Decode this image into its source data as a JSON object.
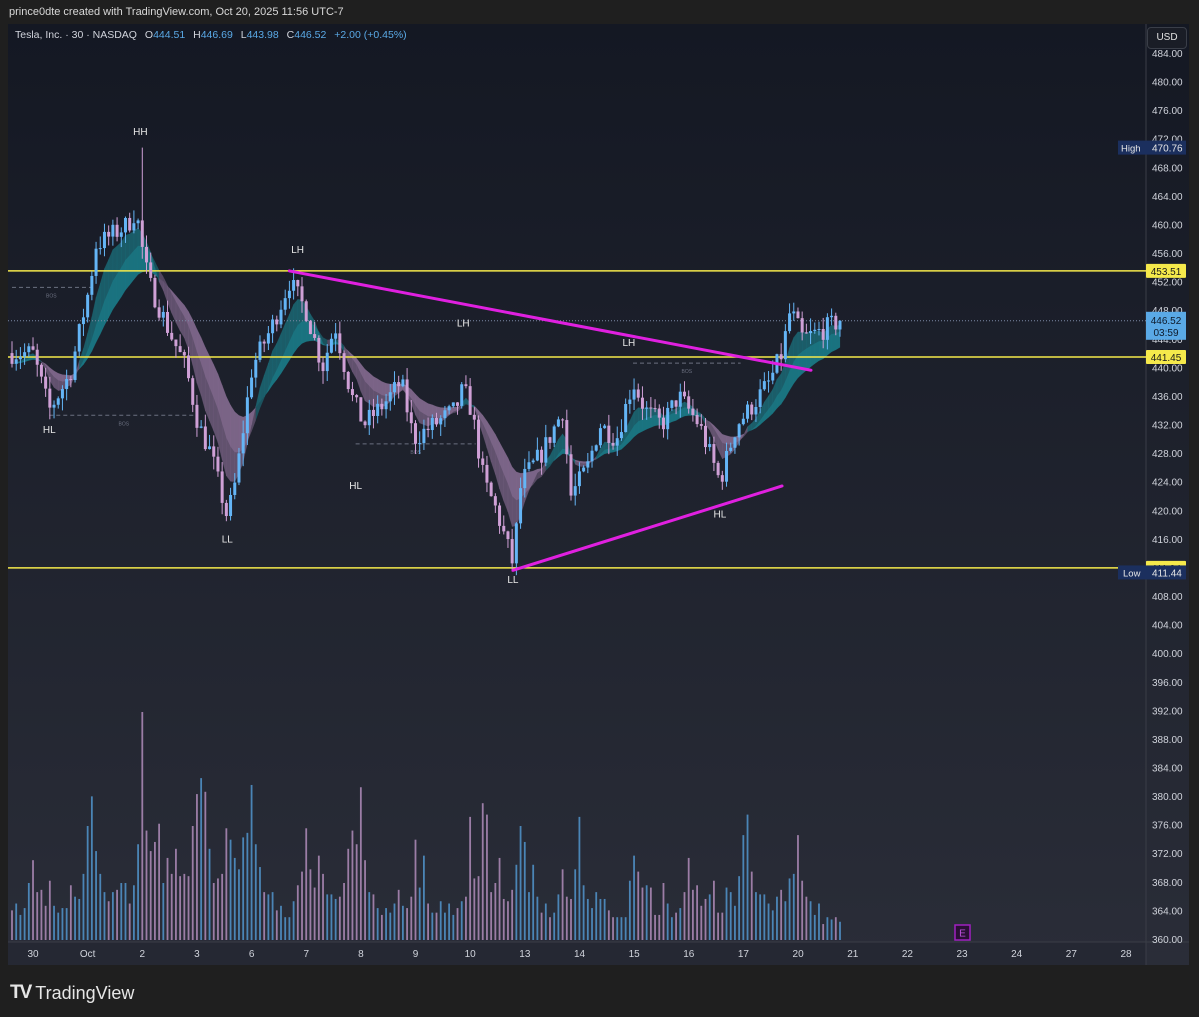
{
  "credit": "prince0dte created with TradingView.com, Oct 20, 2025 11:56 UTC-7",
  "legend": {
    "symbol": "Tesla, Inc. · 30 · NASDAQ",
    "o_label": "O",
    "o": "444.51",
    "h_label": "H",
    "h": "446.69",
    "l_label": "L",
    "l": "443.98",
    "c_label": "C",
    "c": "446.52",
    "change": "+2.00 (+0.45%)"
  },
  "currency_button": "USD",
  "branding": {
    "mark": "TV",
    "name": "TradingView"
  },
  "colors": {
    "up": "#64b5f6",
    "down": "#cfa0d6",
    "ribbon_up": "#1b8f9c",
    "ribbon_down": "#9a7aa5",
    "level": "#f5e94b",
    "trendline": "#e020e0",
    "vol_up": "#4f8fc4",
    "vol_down": "#a886b2"
  },
  "chart_data": {
    "type": "candlestick",
    "title": "Tesla, Inc. · 30 · NASDAQ",
    "interval": "30",
    "ylim": [
      360,
      484
    ],
    "y_ticks": [
      "484.00",
      "480.00",
      "476.00",
      "472.00",
      "468.00",
      "464.00",
      "460.00",
      "456.00",
      "452.00",
      "448.00",
      "444.00",
      "440.00",
      "436.00",
      "432.00",
      "428.00",
      "424.00",
      "420.00",
      "416.00",
      "412.00",
      "408.00",
      "404.00",
      "400.00",
      "396.00",
      "392.00",
      "388.00",
      "384.00",
      "380.00",
      "376.00",
      "372.00",
      "368.00",
      "364.00",
      "360.00"
    ],
    "x_ticks": [
      "30",
      "Oct",
      "2",
      "3",
      "6",
      "7",
      "8",
      "9",
      "10",
      "13",
      "14",
      "15",
      "16",
      "17",
      "20",
      "21",
      "22",
      "23",
      "24",
      "27",
      "28"
    ],
    "price_path": [
      [
        0,
        442
      ],
      [
        5,
        442
      ],
      [
        9,
        434
      ],
      [
        14,
        439
      ],
      [
        19,
        452
      ],
      [
        20,
        457
      ],
      [
        28,
        460
      ],
      [
        30,
        462
      ],
      [
        31,
        458
      ],
      [
        33,
        452
      ],
      [
        38,
        445
      ],
      [
        42,
        440
      ],
      [
        45,
        432
      ],
      [
        48,
        428
      ],
      [
        52,
        419
      ],
      [
        54,
        424
      ],
      [
        58,
        440
      ],
      [
        63,
        446
      ],
      [
        67,
        452
      ],
      [
        71,
        448
      ],
      [
        75,
        440
      ],
      [
        78,
        446
      ],
      [
        82,
        436
      ],
      [
        85,
        432
      ],
      [
        90,
        435
      ],
      [
        94,
        438
      ],
      [
        97,
        430
      ],
      [
        102,
        432
      ],
      [
        107,
        434
      ],
      [
        109,
        437
      ],
      [
        111,
        434
      ],
      [
        114,
        424
      ],
      [
        117,
        420
      ],
      [
        121,
        412.5
      ],
      [
        123,
        424
      ],
      [
        128,
        428
      ],
      [
        133,
        434
      ],
      [
        135,
        422
      ],
      [
        139,
        426
      ],
      [
        142,
        432
      ],
      [
        146,
        430
      ],
      [
        150,
        438
      ],
      [
        153,
        434
      ],
      [
        157,
        432
      ],
      [
        161,
        436
      ],
      [
        166,
        432
      ],
      [
        171,
        424
      ],
      [
        175,
        432
      ],
      [
        178,
        434
      ],
      [
        183,
        438
      ],
      [
        186,
        442
      ],
      [
        188,
        448
      ],
      [
        191,
        444
      ],
      [
        195,
        445
      ],
      [
        200,
        446.52
      ]
    ],
    "session_high": {
      "label": "High",
      "value": "470.76",
      "bar": 31
    },
    "session_low": {
      "label": "Low",
      "value": "411.44",
      "bar": 121
    },
    "last_price": {
      "value": "446.52",
      "countdown": "03:59"
    },
    "volume_relative": [
      13,
      16,
      11,
      14,
      25,
      35,
      21,
      22,
      15,
      26,
      15,
      12,
      14,
      14,
      24,
      19,
      18,
      29,
      50,
      63,
      39,
      29,
      21,
      17,
      21,
      22,
      25,
      25,
      16,
      24,
      42,
      100,
      48,
      39,
      43,
      51,
      25,
      36,
      29,
      40,
      28,
      29,
      28,
      50,
      64,
      71,
      65,
      40,
      25,
      27,
      29,
      49,
      44,
      36,
      31,
      45,
      47,
      68,
      42,
      32,
      21,
      20,
      21,
      13,
      15,
      10,
      10,
      17,
      24,
      30,
      49,
      31,
      23,
      37,
      29,
      20,
      20,
      18,
      19,
      25,
      40,
      48,
      42,
      67,
      35,
      21,
      20,
      14,
      11,
      14,
      12,
      16,
      22,
      15,
      14,
      19,
      44,
      23,
      37,
      16,
      12,
      12,
      17,
      12,
      16,
      11,
      14,
      17,
      19,
      54,
      27,
      28,
      60,
      55,
      21,
      25,
      36,
      18,
      17,
      22,
      33,
      50,
      43,
      21,
      33,
      19,
      12,
      16,
      10,
      12,
      20,
      31,
      19,
      18,
      31,
      54,
      24,
      18,
      14,
      21,
      18,
      18,
      13,
      10,
      10,
      10,
      10,
      26,
      37,
      30,
      23,
      24,
      23,
      11,
      11,
      25,
      16,
      10,
      12,
      14,
      21,
      36,
      22,
      24,
      15,
      18,
      20,
      26,
      12,
      12,
      23,
      21,
      15,
      28,
      46,
      55,
      30,
      21,
      20,
      20,
      16,
      13,
      19,
      22,
      17,
      27,
      29,
      46,
      26,
      19,
      17,
      11,
      16,
      7,
      10,
      9,
      10,
      8
    ],
    "levels": [
      {
        "price": 453.51,
        "label": "453.51"
      },
      {
        "price": 441.45,
        "label": "441.45"
      },
      {
        "price": 411.94,
        "label": "411.94"
      }
    ],
    "trendlines": [
      {
        "name": "descending-resistance",
        "from": [
          67,
          453.5
        ],
        "to": [
          193,
          439.6
        ]
      },
      {
        "name": "ascending-support",
        "from": [
          121,
          411.6
        ],
        "to": [
          186,
          423.4
        ]
      }
    ],
    "structure_labels": [
      {
        "text": "HH",
        "bar": 31,
        "price": 472.5
      },
      {
        "text": "LH",
        "bar": 69,
        "price": 456
      },
      {
        "text": "LH",
        "bar": 109,
        "price": 445.7
      },
      {
        "text": "LH",
        "bar": 149,
        "price": 443
      },
      {
        "text": "HL",
        "bar": 9,
        "price": 430.8
      },
      {
        "text": "LL",
        "bar": 52,
        "price": 415.5
      },
      {
        "text": "HL",
        "bar": 83,
        "price": 423
      },
      {
        "text": "LL",
        "bar": 121,
        "price": 409.8
      },
      {
        "text": "HL",
        "bar": 171,
        "price": 419
      }
    ],
    "bos_lines": [
      {
        "label": "BOS",
        "from_bar": 0,
        "to_bar": 19,
        "price": 451.2
      },
      {
        "label": "BOS",
        "from_bar": 9,
        "to_bar": 45,
        "price": 433.3
      },
      {
        "label": "BOS",
        "from_bar": 83,
        "to_bar": 112,
        "price": 429.3
      },
      {
        "label": "BOS",
        "from_bar": 150,
        "to_bar": 176,
        "price": 440.6
      }
    ],
    "earnings_marker": {
      "label": "E",
      "date": "23"
    }
  }
}
